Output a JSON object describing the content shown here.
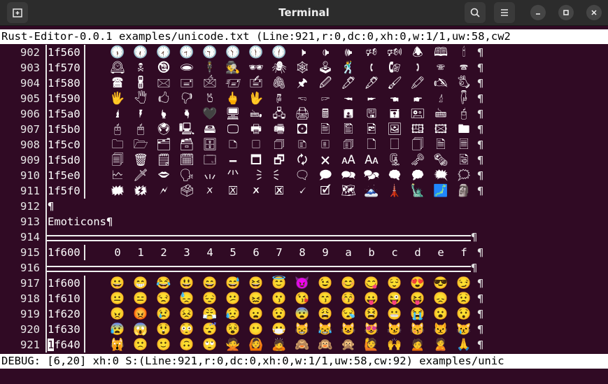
{
  "window": {
    "title": "Terminal",
    "new_tab_icon": "new-tab-icon",
    "search_icon": "search-icon",
    "menu_icon": "hamburger-menu-icon",
    "minimize_icon": "minimize-icon",
    "maximize_icon": "maximize-icon",
    "close_icon": "close-icon"
  },
  "top_status": "Rust-Editor-0.0.1 examples/unicode.txt (Line:921,r:0,dc:0,xh:0,w:1/1,uw:58,cw2",
  "bottom_status": "DEBUG: [6,20] xh:0 S:(Line:921,r:0,dc:0,xh:0,w:1/1,uw:58,cw:92) examples/unic",
  "pilcrow": "¶",
  "rows": [
    {
      "num": "902",
      "code": "1f560",
      "cells": [
        "🕠",
        "🕡",
        "🕢",
        "🕣",
        "🕤",
        "🕥",
        "🕦",
        "🕧",
        "🕨",
        "🕩",
        "🕪",
        "🕫",
        "🕬",
        "🕭",
        "🕮",
        "🕯"
      ]
    },
    {
      "num": "903",
      "code": "1f570",
      "cells": [
        "🕰",
        "🕱",
        "🕲",
        "🕳",
        "🕴",
        "🕵",
        "🕶",
        "🕷",
        "🕸",
        "🕹",
        "🕺",
        "🕻",
        "🕼",
        "🕽",
        "🕾",
        "🕿"
      ]
    },
    {
      "num": "904",
      "code": "1f580",
      "cells": [
        "🖀",
        "🖁",
        "🖂",
        "🖃",
        "🖄",
        "🖅",
        "🖆",
        "🖇",
        "🖈",
        "🖉",
        "🖊",
        "🖋",
        "🖌",
        "🖍",
        "🖎",
        "🖏"
      ]
    },
    {
      "num": "905",
      "code": "1f590",
      "cells": [
        "🖐",
        "🖑",
        "🖒",
        "🖓",
        "🖔",
        "🖕",
        "🖖",
        "🖗",
        "🖘",
        "🖙",
        "🖚",
        "🖛",
        "🖜",
        "🖝",
        "🖞",
        "🖟"
      ]
    },
    {
      "num": "906",
      "code": "1f5a0",
      "cells": [
        "🖠",
        "🖡",
        "🖢",
        "🖣",
        "🖤",
        "🖥",
        "🖦",
        "🖧",
        "🖨",
        "🖩",
        "🖪",
        "🖫",
        "🖬",
        "🖭",
        "🖮",
        "🖯"
      ]
    },
    {
      "num": "907",
      "code": "1f5b0",
      "cells": [
        "🖰",
        "🖱",
        "🖲",
        "🖳",
        "🖴",
        "🖵",
        "🖶",
        "🖷",
        "🖸",
        "🖹",
        "🖺",
        "🖻",
        "🖼",
        "🖽",
        "🖾",
        "🖿"
      ]
    },
    {
      "num": "908",
      "code": "1f5c0",
      "cells": [
        "🗀",
        "🗁",
        "🗂",
        "🗃",
        "🗄",
        "🗅",
        "🗆",
        "🗇",
        "🗈",
        "🗉",
        "🗊",
        "🗋",
        "🗌",
        "🗍",
        "🗎",
        "🗏"
      ]
    },
    {
      "num": "909",
      "code": "1f5d0",
      "cells": [
        "🗐",
        "🗑",
        "🗒",
        "🗓",
        "🗔",
        "🗕",
        "🗖",
        "🗗",
        "🗘",
        "🗙",
        "🗚",
        "🗛",
        "🗜",
        "🗝",
        "🗞",
        "🗟"
      ]
    },
    {
      "num": "910",
      "code": "1f5e0",
      "cells": [
        "🗠",
        "🗡",
        "🗢",
        "🗣",
        "🗤",
        "🗥",
        "🗦",
        "🗧",
        "🗨",
        "🗩",
        "🗪",
        "🗫",
        "🗬",
        "🗭",
        "🗮",
        "🗯"
      ]
    },
    {
      "num": "911",
      "code": "1f5f0",
      "cells": [
        "🗰",
        "🗱",
        "🗲",
        "🗳",
        "🗴",
        "🗵",
        "🗶",
        "🗷",
        "🗸",
        "🗹",
        "🗺",
        "🗻",
        "🗼",
        "🗽",
        "🗾",
        "🗿"
      ]
    },
    {
      "num": "912",
      "text": "¶"
    },
    {
      "num": "913",
      "text": "Emoticons¶"
    },
    {
      "num": "914",
      "rule": true
    },
    {
      "num": "915",
      "code": "1f600",
      "cells": [
        "0",
        "1",
        "2",
        "3",
        "4",
        "5",
        "6",
        "7",
        "8",
        "9",
        "a",
        "b",
        "c",
        "d",
        "e",
        "f"
      ],
      "header": true
    },
    {
      "num": "916",
      "rule": true
    },
    {
      "num": "917",
      "code": "1f600",
      "cells": [
        "😀",
        "😁",
        "😂",
        "😃",
        "😄",
        "😅",
        "😆",
        "😇",
        "😈",
        "😉",
        "😊",
        "😋",
        "😌",
        "😍",
        "😎",
        "😏"
      ]
    },
    {
      "num": "918",
      "code": "1f610",
      "cells": [
        "😐",
        "😑",
        "😒",
        "😓",
        "😔",
        "😕",
        "😖",
        "😗",
        "😘",
        "😙",
        "😚",
        "😛",
        "😜",
        "😝",
        "😞",
        "😟"
      ]
    },
    {
      "num": "919",
      "code": "1f620",
      "cells": [
        "😠",
        "😡",
        "😢",
        "😣",
        "😤",
        "😥",
        "😦",
        "😧",
        "😨",
        "😩",
        "😪",
        "😫",
        "😬",
        "😭",
        "😮",
        "😯"
      ]
    },
    {
      "num": "920",
      "code": "1f630",
      "cells": [
        "😰",
        "😱",
        "😲",
        "😳",
        "😴",
        "😵",
        "😶",
        "😷",
        "😸",
        "😹",
        "😺",
        "😻",
        "😼",
        "😽",
        "😾",
        "😿"
      ]
    },
    {
      "num": "921",
      "code": "1f640",
      "cells": [
        "🙀",
        "🙁",
        "🙂",
        "🙃",
        "🙄",
        "🙅",
        "🙆",
        "🙇",
        "🙈",
        "🙉",
        "🙊",
        "🙋",
        "🙌",
        "🙍",
        "🙎",
        "🙏"
      ],
      "cursor": true
    }
  ]
}
